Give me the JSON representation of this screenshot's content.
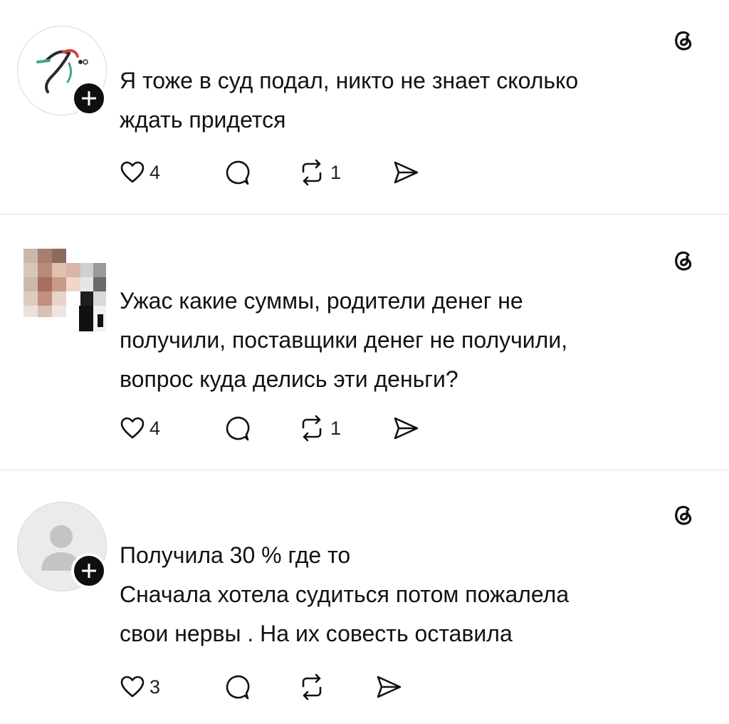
{
  "posts": [
    {
      "avatar": "brand-logo-avatar",
      "lines": [
        "Я тоже в суд подал, никто не знает сколько",
        "ждать придется"
      ],
      "likes": "4",
      "reposts": "1",
      "icons": [
        "heart-icon",
        "comment-icon",
        "repost-icon",
        "share-icon",
        "threads-logo-icon",
        "follow-plus-icon"
      ]
    },
    {
      "avatar": "pixelated-photo-avatar",
      "lines": [
        "Ужас какие суммы, родители денег не",
        "получили, поставщики денег не получили,",
        "вопрос куда делись эти деньги?"
      ],
      "likes": "4",
      "reposts": "1",
      "icons": [
        "heart-icon",
        "comment-icon",
        "repost-icon",
        "share-icon",
        "threads-logo-icon"
      ]
    },
    {
      "avatar": "default-user-avatar",
      "lines": [
        "Получила 30 % где то",
        "Сначала хотела судиться потом пожалела",
        "свои нервы . На их совесть оставила"
      ],
      "likes": "3",
      "reposts": "",
      "icons": [
        "heart-icon",
        "comment-icon",
        "repost-icon",
        "share-icon",
        "threads-logo-icon",
        "follow-plus-icon"
      ]
    }
  ],
  "colors": {
    "text": "#121212",
    "divider": "#e3e3e3",
    "icon": "#111111",
    "badge": "#0f0f0f"
  }
}
